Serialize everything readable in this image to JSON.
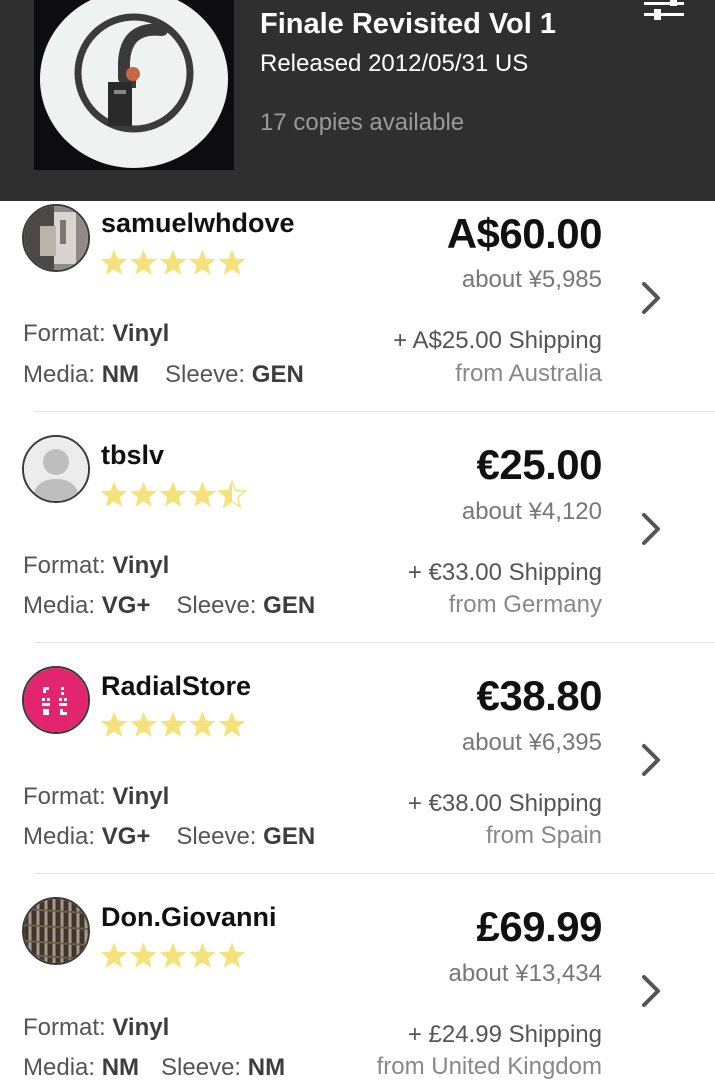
{
  "release": {
    "title": "Finale Revisited Vol 1",
    "released": "Released 2012/05/31 US",
    "copies": "17 copies available"
  },
  "icons": {
    "filter": "sliders-icon",
    "chevron": "chevron-right-icon",
    "star": "star-icon"
  },
  "colors": {
    "header_bg": "#2f2f2f",
    "star_fill": "#f5e27c",
    "star_empty": "#ffffff",
    "radial_avatar": "#e3246e"
  },
  "listings": [
    {
      "seller": "samuelwhdove",
      "rating": 5,
      "price": "A$60.00",
      "approx": "about ¥5,985",
      "format_label": "Format:",
      "format": "Vinyl",
      "media_label": "Media:",
      "media": "NM",
      "sleeve_label": "Sleeve:",
      "sleeve": "GEN",
      "shipping": "+ A$25.00 Shipping",
      "from": "from Australia"
    },
    {
      "seller": "tbslv",
      "rating": 4.5,
      "price": "€25.00",
      "approx": "about ¥4,120",
      "format_label": "Format:",
      "format": "Vinyl",
      "media_label": "Media:",
      "media": "VG+",
      "sleeve_label": "Sleeve:",
      "sleeve": "GEN",
      "shipping": "+ €33.00 Shipping",
      "from": "from Germany"
    },
    {
      "seller": "RadialStore",
      "rating": 5,
      "price": "€38.80",
      "approx": "about ¥6,395",
      "format_label": "Format:",
      "format": "Vinyl",
      "media_label": "Media:",
      "media": "VG+",
      "sleeve_label": "Sleeve:",
      "sleeve": "GEN",
      "shipping": "+ €38.00 Shipping",
      "from": "from Spain"
    },
    {
      "seller": "Don.Giovanni",
      "rating": 5,
      "price": "£69.99",
      "approx": "about ¥13,434",
      "format_label": "Format:",
      "format": "Vinyl",
      "media_label": "Media:",
      "media": "NM",
      "sleeve_label": "Sleeve:",
      "sleeve": "NM",
      "shipping": "+ £24.99 Shipping",
      "from": "from United Kingdom"
    }
  ]
}
